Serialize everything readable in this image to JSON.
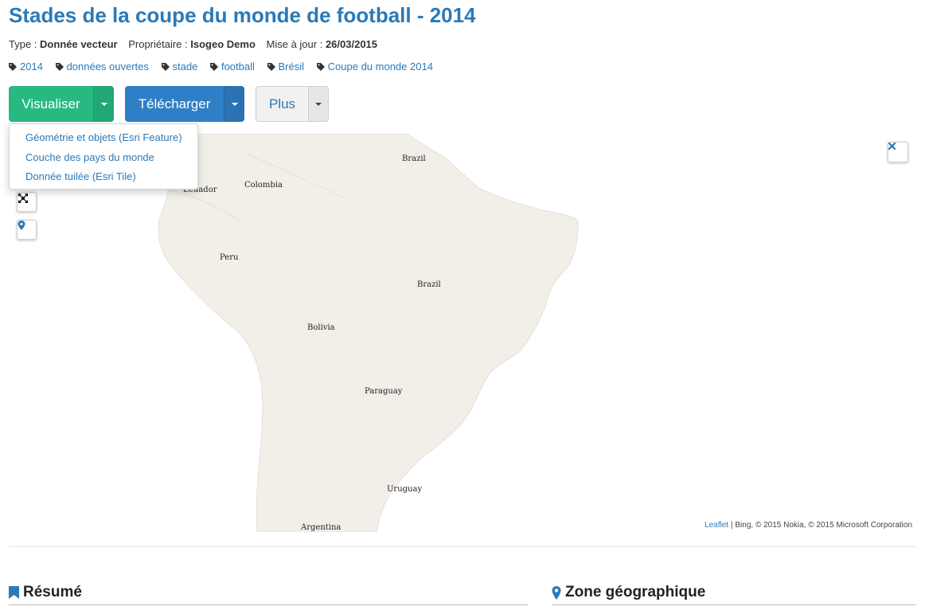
{
  "title": "Stades de la coupe du monde de football - 2014",
  "meta": {
    "type_label": "Type :",
    "type_value": "Donnée vecteur",
    "owner_label": "Propriétaire :",
    "owner_value": "Isogeo Demo",
    "updated_label": "Mise à jour :",
    "updated_value": "26/03/2015"
  },
  "tags": [
    "2014",
    "données ouvertes",
    "stade",
    "football",
    "Brésil",
    "Coupe du monde 2014"
  ],
  "buttons": {
    "visualize": "Visualiser",
    "download": "Télécharger",
    "more": "Plus"
  },
  "visualize_menu": [
    "Géométrie et objets (Esri Feature)",
    "Couche des pays du monde",
    "Donnée tuilée (Esri Tile)"
  ],
  "map": {
    "labels": {
      "brazil_north": "Brazil",
      "colombia": "Colombia",
      "ecuador": "Ecuador",
      "peru": "Peru",
      "brazil": "Brazil",
      "bolivia": "Bolivia",
      "paraguay": "Paraguay",
      "uruguay": "Uruguay",
      "argentina": "Argentina"
    },
    "attribution_link": "Leaflet",
    "attribution_text": " | Bing, © 2015 Nokia, © 2015 Microsoft Corporation",
    "land_color": "#f2efe9"
  },
  "sections": {
    "summary": "Résumé",
    "geo_zone": "Zone géographique"
  },
  "colors": {
    "title": "#2a7ab8",
    "visualize_btn": "#27b981",
    "download_btn": "#2f7fc6",
    "link": "#2a7ab8"
  }
}
